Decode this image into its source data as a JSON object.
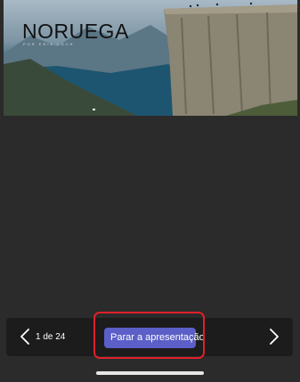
{
  "slide": {
    "title": "NORUEGA",
    "subtitle": "POR ERIK LOCH"
  },
  "controls": {
    "page_indicator": "1 de 24",
    "stop_button_label": "Parar a apresentação",
    "prev_icon": "chevron-left-icon",
    "next_icon": "chevron-right-icon"
  },
  "colors": {
    "background": "#2b2b2b",
    "control_bar": "#1c1c1c",
    "accent_button": "#5b5fc7",
    "highlight": "#e0202a"
  }
}
